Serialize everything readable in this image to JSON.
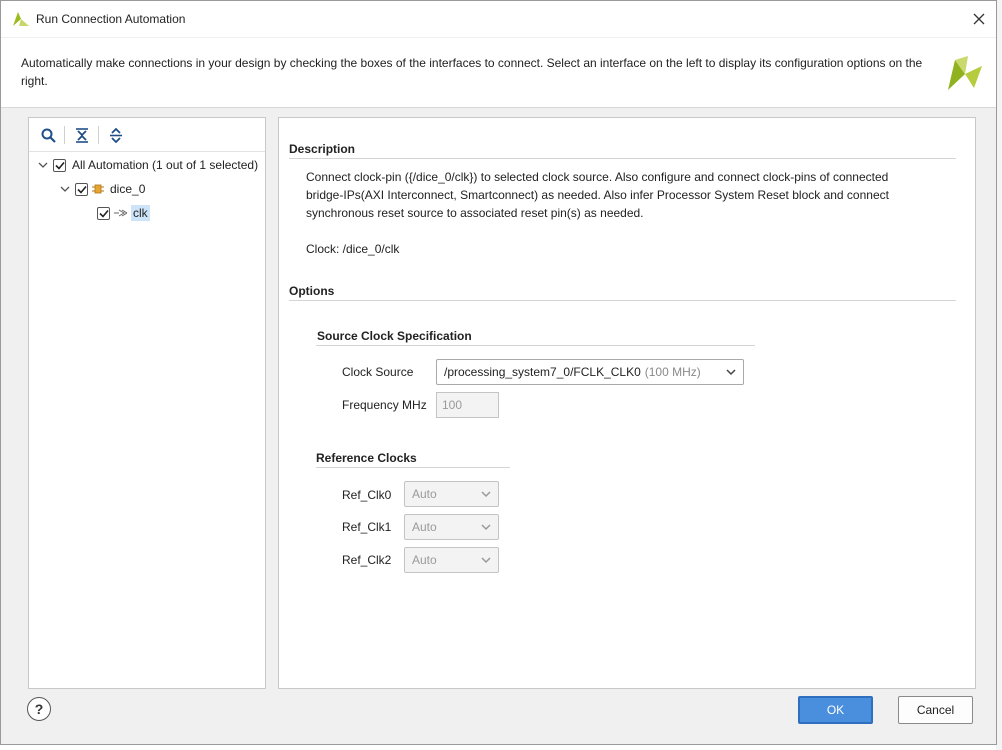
{
  "window": {
    "title": "Run Connection Automation",
    "brand_color": "#9bbc1e"
  },
  "intro": {
    "text": "Automatically make connections in your design by checking the boxes of the interfaces to connect. Select an interface on the left to display its configuration options on the right."
  },
  "tree": {
    "toolbar": [
      "search-icon",
      "collapse-all-icon",
      "expand-all-icon"
    ],
    "root": {
      "label": "All Automation (1 out of 1 selected)",
      "checked": true,
      "expanded": true
    },
    "instance": {
      "label": "dice_0",
      "checked": true,
      "expanded": true,
      "icon": "ip-block-icon"
    },
    "pin": {
      "label": "clk",
      "checked": true,
      "selected": true,
      "icon": "clock-pin-icon"
    }
  },
  "description": {
    "heading": "Description",
    "text": "Connect clock-pin ({/dice_0/clk}) to selected clock source. Also configure and connect clock-pins of connected bridge-IPs(AXI Interconnect, Smartconnect) as needed. Also infer Processor System Reset block and connect synchronous reset source to associated reset pin(s) as needed.",
    "clock_line": "Clock: /dice_0/clk"
  },
  "options": {
    "heading": "Options",
    "source_clock": {
      "heading": "Source Clock Specification",
      "clock_source_label": "Clock Source",
      "clock_source_value": "/processing_system7_0/FCLK_CLK0",
      "clock_source_freq": "(100 MHz)",
      "frequency_label": "Frequency MHz",
      "frequency_value": "100"
    },
    "reference_clocks": {
      "heading": "Reference Clocks",
      "items": [
        {
          "label": "Ref_Clk0",
          "value": "Auto"
        },
        {
          "label": "Ref_Clk1",
          "value": "Auto"
        },
        {
          "label": "Ref_Clk2",
          "value": "Auto"
        }
      ]
    }
  },
  "footer": {
    "help_label": "?",
    "ok_label": "OK",
    "cancel_label": "Cancel"
  }
}
